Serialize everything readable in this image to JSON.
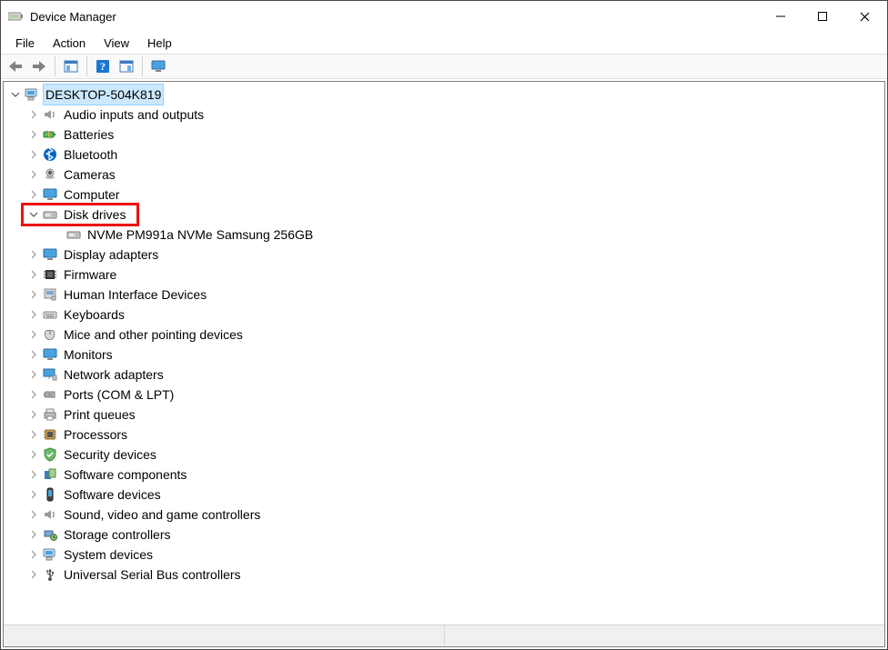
{
  "window": {
    "title": "Device Manager"
  },
  "menu": {
    "file": "File",
    "action": "Action",
    "view": "View",
    "help": "Help"
  },
  "toolbar": {
    "back": "back",
    "forward": "forward",
    "show_hide_tree": "show-hide-console-tree",
    "help_topics": "help",
    "action_pane": "show-hide-action-pane",
    "monitor": "display-properties"
  },
  "root": {
    "label": "DESKTOP-504K819",
    "expanded": true
  },
  "categories": [
    {
      "id": "audio",
      "label": "Audio inputs and outputs",
      "expanded": false,
      "icon": "speaker"
    },
    {
      "id": "batteries",
      "label": "Batteries",
      "expanded": false,
      "icon": "battery"
    },
    {
      "id": "bluetooth",
      "label": "Bluetooth",
      "expanded": false,
      "icon": "bluetooth"
    },
    {
      "id": "cameras",
      "label": "Cameras",
      "expanded": false,
      "icon": "camera"
    },
    {
      "id": "computer",
      "label": "Computer",
      "expanded": false,
      "icon": "monitor"
    },
    {
      "id": "disk",
      "label": "Disk drives",
      "expanded": true,
      "icon": "disk",
      "children": [
        {
          "label": "NVMe PM991a NVMe Samsung 256GB",
          "icon": "disk"
        }
      ]
    },
    {
      "id": "display",
      "label": "Display adapters",
      "expanded": false,
      "icon": "monitor"
    },
    {
      "id": "firmware",
      "label": "Firmware",
      "expanded": false,
      "icon": "chip-dark"
    },
    {
      "id": "hid",
      "label": "Human Interface Devices",
      "expanded": false,
      "icon": "hid"
    },
    {
      "id": "keyboards",
      "label": "Keyboards",
      "expanded": false,
      "icon": "keyboard"
    },
    {
      "id": "mice",
      "label": "Mice and other pointing devices",
      "expanded": false,
      "icon": "mouse"
    },
    {
      "id": "monitors",
      "label": "Monitors",
      "expanded": false,
      "icon": "monitor"
    },
    {
      "id": "network",
      "label": "Network adapters",
      "expanded": false,
      "icon": "network"
    },
    {
      "id": "ports",
      "label": "Ports (COM & LPT)",
      "expanded": false,
      "icon": "port"
    },
    {
      "id": "printq",
      "label": "Print queues",
      "expanded": false,
      "icon": "printer"
    },
    {
      "id": "proc",
      "label": "Processors",
      "expanded": false,
      "icon": "chip"
    },
    {
      "id": "security",
      "label": "Security devices",
      "expanded": false,
      "icon": "shield"
    },
    {
      "id": "swcomp",
      "label": "Software components",
      "expanded": false,
      "icon": "swcomp"
    },
    {
      "id": "swdev",
      "label": "Software devices",
      "expanded": false,
      "icon": "swdev"
    },
    {
      "id": "sound",
      "label": "Sound, video and game controllers",
      "expanded": false,
      "icon": "speaker"
    },
    {
      "id": "storage",
      "label": "Storage controllers",
      "expanded": false,
      "icon": "storage"
    },
    {
      "id": "system",
      "label": "System devices",
      "expanded": false,
      "icon": "computer-sm"
    },
    {
      "id": "usb",
      "label": "Universal Serial Bus controllers",
      "expanded": false,
      "icon": "usb"
    }
  ],
  "highlight": {
    "target_id": "disk"
  }
}
